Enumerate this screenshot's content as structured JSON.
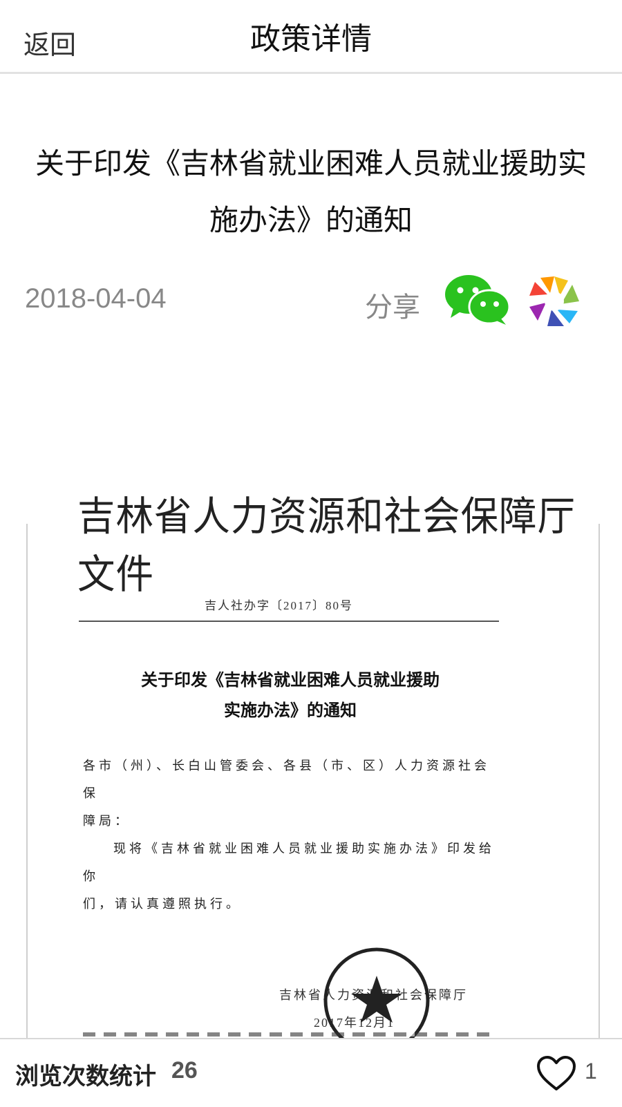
{
  "header": {
    "back_label": "返回",
    "title": "政策详情"
  },
  "article": {
    "title": "关于印发《吉林省就业困难人员就业援助实施办法》的通知",
    "date": "2018-04-04",
    "share_label": "分享",
    "share_icons": [
      "wechat-icon",
      "moments-icon"
    ]
  },
  "document": {
    "header": "吉林省人力资源和社会保障厅文件",
    "ref_number": "吉人社办字〔2017〕80号",
    "title_line1": "关于印发《吉林省就业困难人员就业援助",
    "title_line2": "实施办法》的通知",
    "body": [
      "各市（州）、长白山管委会、各县（市、区）人力资源社会保",
      "障局：",
      "现将《吉林省就业困难人员就业援助实施办法》印发给你",
      "们，请认真遵照执行。"
    ],
    "signer": "吉林省人力资源和社会保障厅",
    "date": "2017年12月1"
  },
  "footer": {
    "views_label": "浏览次数统计",
    "views_count": "26",
    "like_count": "1",
    "like_icon": "heart-icon"
  },
  "colors": {
    "muted": "#888888",
    "wechat_green": "#2ac21f"
  }
}
